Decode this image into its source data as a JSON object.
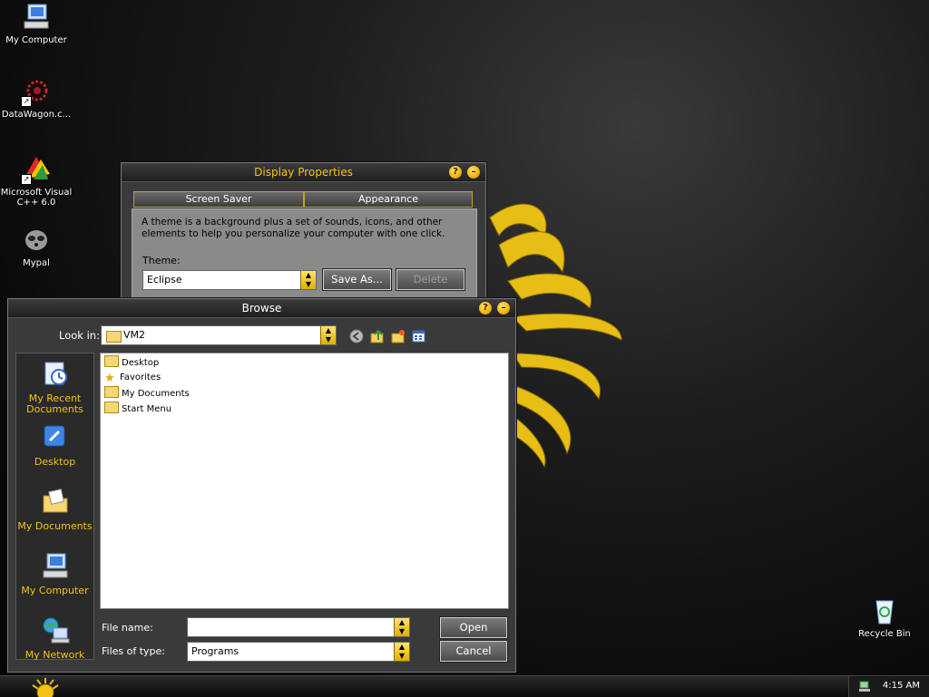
{
  "desktop": {
    "icons": [
      {
        "label": "My Computer"
      },
      {
        "label": "DataWagon.c..."
      },
      {
        "label": "Microsoft Visual C++ 6.0"
      },
      {
        "label": "Mypal"
      },
      {
        "label": "Recycle Bin"
      }
    ]
  },
  "display_properties": {
    "title": "Display Properties",
    "tabs": [
      "Screen Saver",
      "Appearance"
    ],
    "description": "A theme is a background plus a set of sounds, icons, and other elements to help you personalize your computer with one click.",
    "theme_label": "Theme:",
    "theme_value": "Eclipse",
    "save_as_label": "Save As...",
    "delete_label": "Delete"
  },
  "browse": {
    "title": "Browse",
    "look_in_label": "Look in:",
    "look_in_value": "VM2",
    "places": [
      {
        "label": "My Recent Documents"
      },
      {
        "label": "Desktop"
      },
      {
        "label": "My Documents"
      },
      {
        "label": "My Computer"
      },
      {
        "label": "My Network"
      }
    ],
    "files": [
      {
        "name": "Desktop",
        "icon": "folder-icon"
      },
      {
        "name": "Favorites",
        "icon": "star-icon"
      },
      {
        "name": "My Documents",
        "icon": "folder-icon"
      },
      {
        "name": "Start Menu",
        "icon": "folder-icon"
      }
    ],
    "file_name_label": "File name:",
    "file_name_value": "",
    "files_of_type_label": "Files of type:",
    "files_of_type_value": "Programs",
    "open_label": "Open",
    "cancel_label": "Cancel"
  },
  "taskbar": {
    "clock": "4:15 AM"
  },
  "colors": {
    "accent": "#f2c21b",
    "window_bg": "#3a3a3a"
  }
}
